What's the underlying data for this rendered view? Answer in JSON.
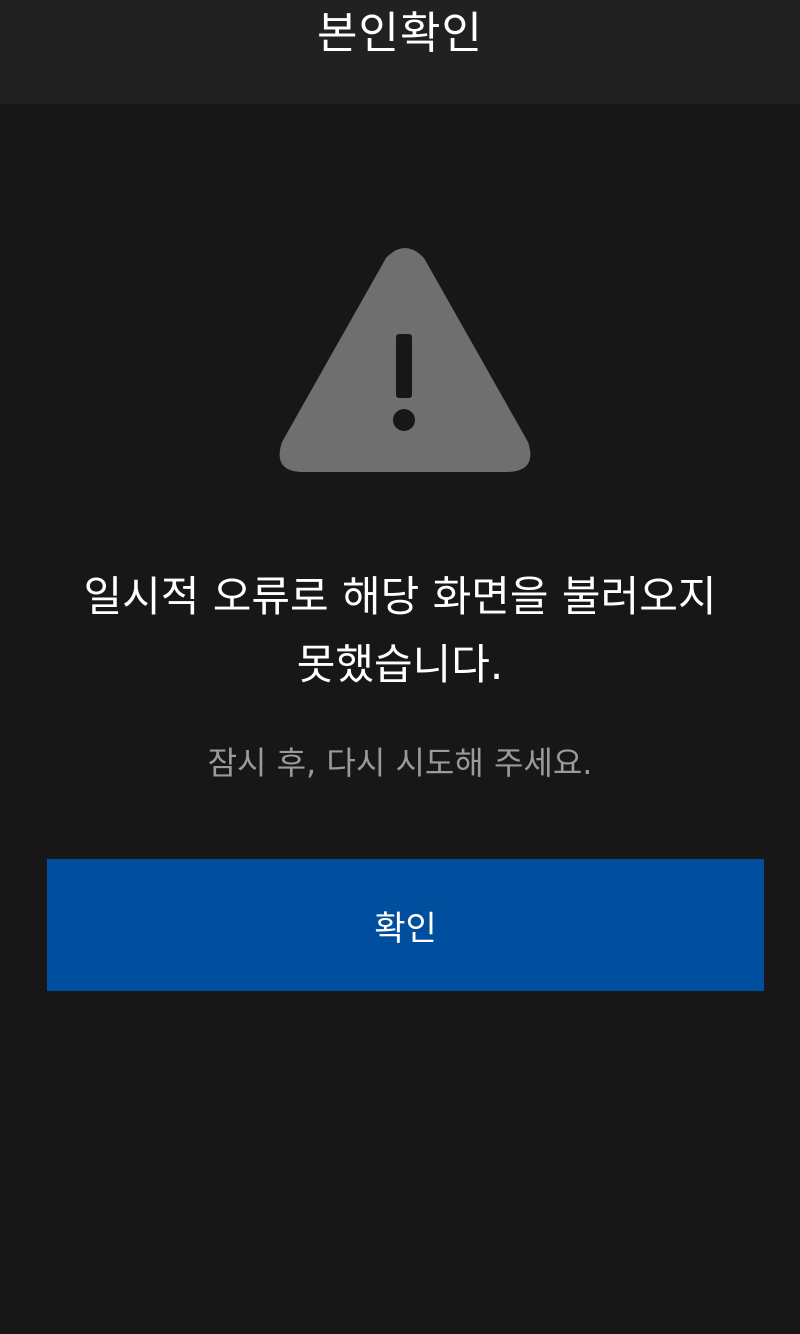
{
  "header": {
    "title": "본인확인"
  },
  "error": {
    "icon": "warning-triangle-icon",
    "message": "일시적 오류로 해당 화면을 불러오지 못했습니다.",
    "sub_message": "잠시 후, 다시 시도해 주세요."
  },
  "actions": {
    "confirm_label": "확인"
  },
  "colors": {
    "background": "#171717",
    "header_background": "#212121",
    "icon": "#6f6f6f",
    "button": "#004f9f",
    "sub_text": "#9a9a9a"
  }
}
